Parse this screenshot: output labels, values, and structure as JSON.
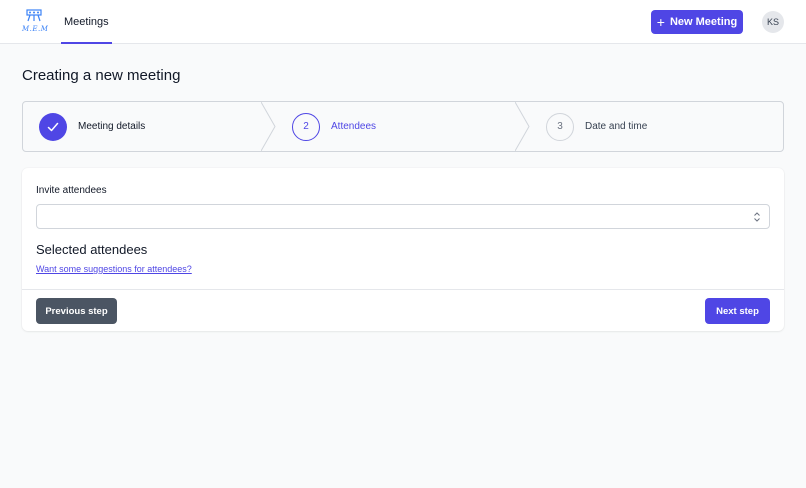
{
  "header": {
    "logo_text": "M.E.M",
    "nav_tab": "Meetings",
    "new_meeting_button": "New Meeting",
    "avatar_initials": "KS"
  },
  "page": {
    "title": "Creating a new meeting"
  },
  "steps": [
    {
      "number": "1",
      "label": "Meeting details",
      "status": "complete"
    },
    {
      "number": "2",
      "label": "Attendees",
      "status": "current"
    },
    {
      "number": "3",
      "label": "Date and time",
      "status": "upcoming"
    }
  ],
  "form": {
    "invite_label": "Invite attendees",
    "invite_value": "",
    "selected_heading": "Selected attendees",
    "suggest_link": "Want some suggestions for attendees?",
    "previous_button": "Previous step",
    "next_button": "Next step"
  },
  "colors": {
    "accent": "#4f46e5",
    "secondary_button": "#4b5563",
    "background": "#f9fafb"
  }
}
